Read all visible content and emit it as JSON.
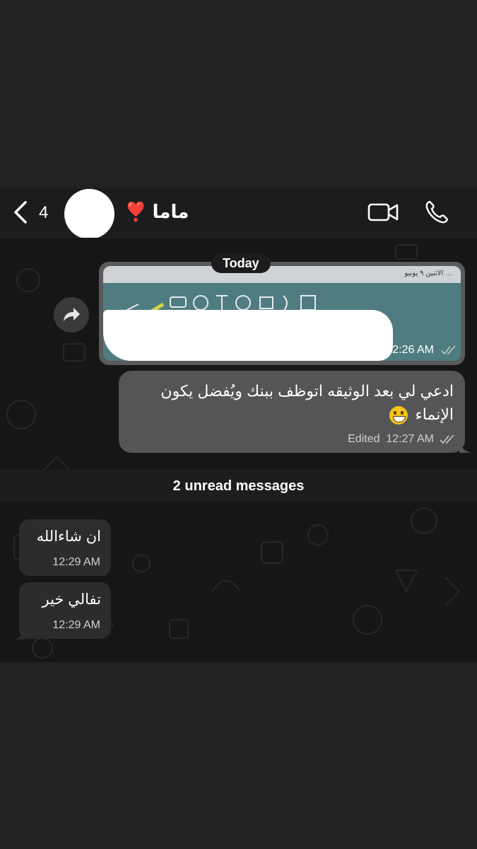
{
  "header": {
    "unread_count": "4",
    "contact_name": "ماما ❣️"
  },
  "chat": {
    "date_label": "Today",
    "image_message": {
      "time": "12:26 AM",
      "preview_text": "… الاثنين ٩ يونيو"
    },
    "outgoing_message": {
      "text": "ادعي لي بعد الوثيقه اتوظف ببنك ويُفضل يكون الإنماء",
      "edited_label": "Edited",
      "time": "12:27 AM"
    },
    "unread_banner": "2 unread messages",
    "incoming_messages": [
      {
        "text": "ان شاءالله",
        "time": "12:29 AM"
      },
      {
        "text": "تفالي خير",
        "time": "12:29 AM"
      }
    ]
  },
  "icons": {
    "back": "chevron-left-icon",
    "video": "video-camera-icon",
    "phone": "phone-icon",
    "forward": "forward-arrow-icon",
    "read_status": "double-check-icon"
  },
  "colors": {
    "header_bg": "#1c1c1e",
    "outgoing_bubble": "#555557",
    "incoming_bubble": "#2c2c2e",
    "background": "#212123"
  }
}
